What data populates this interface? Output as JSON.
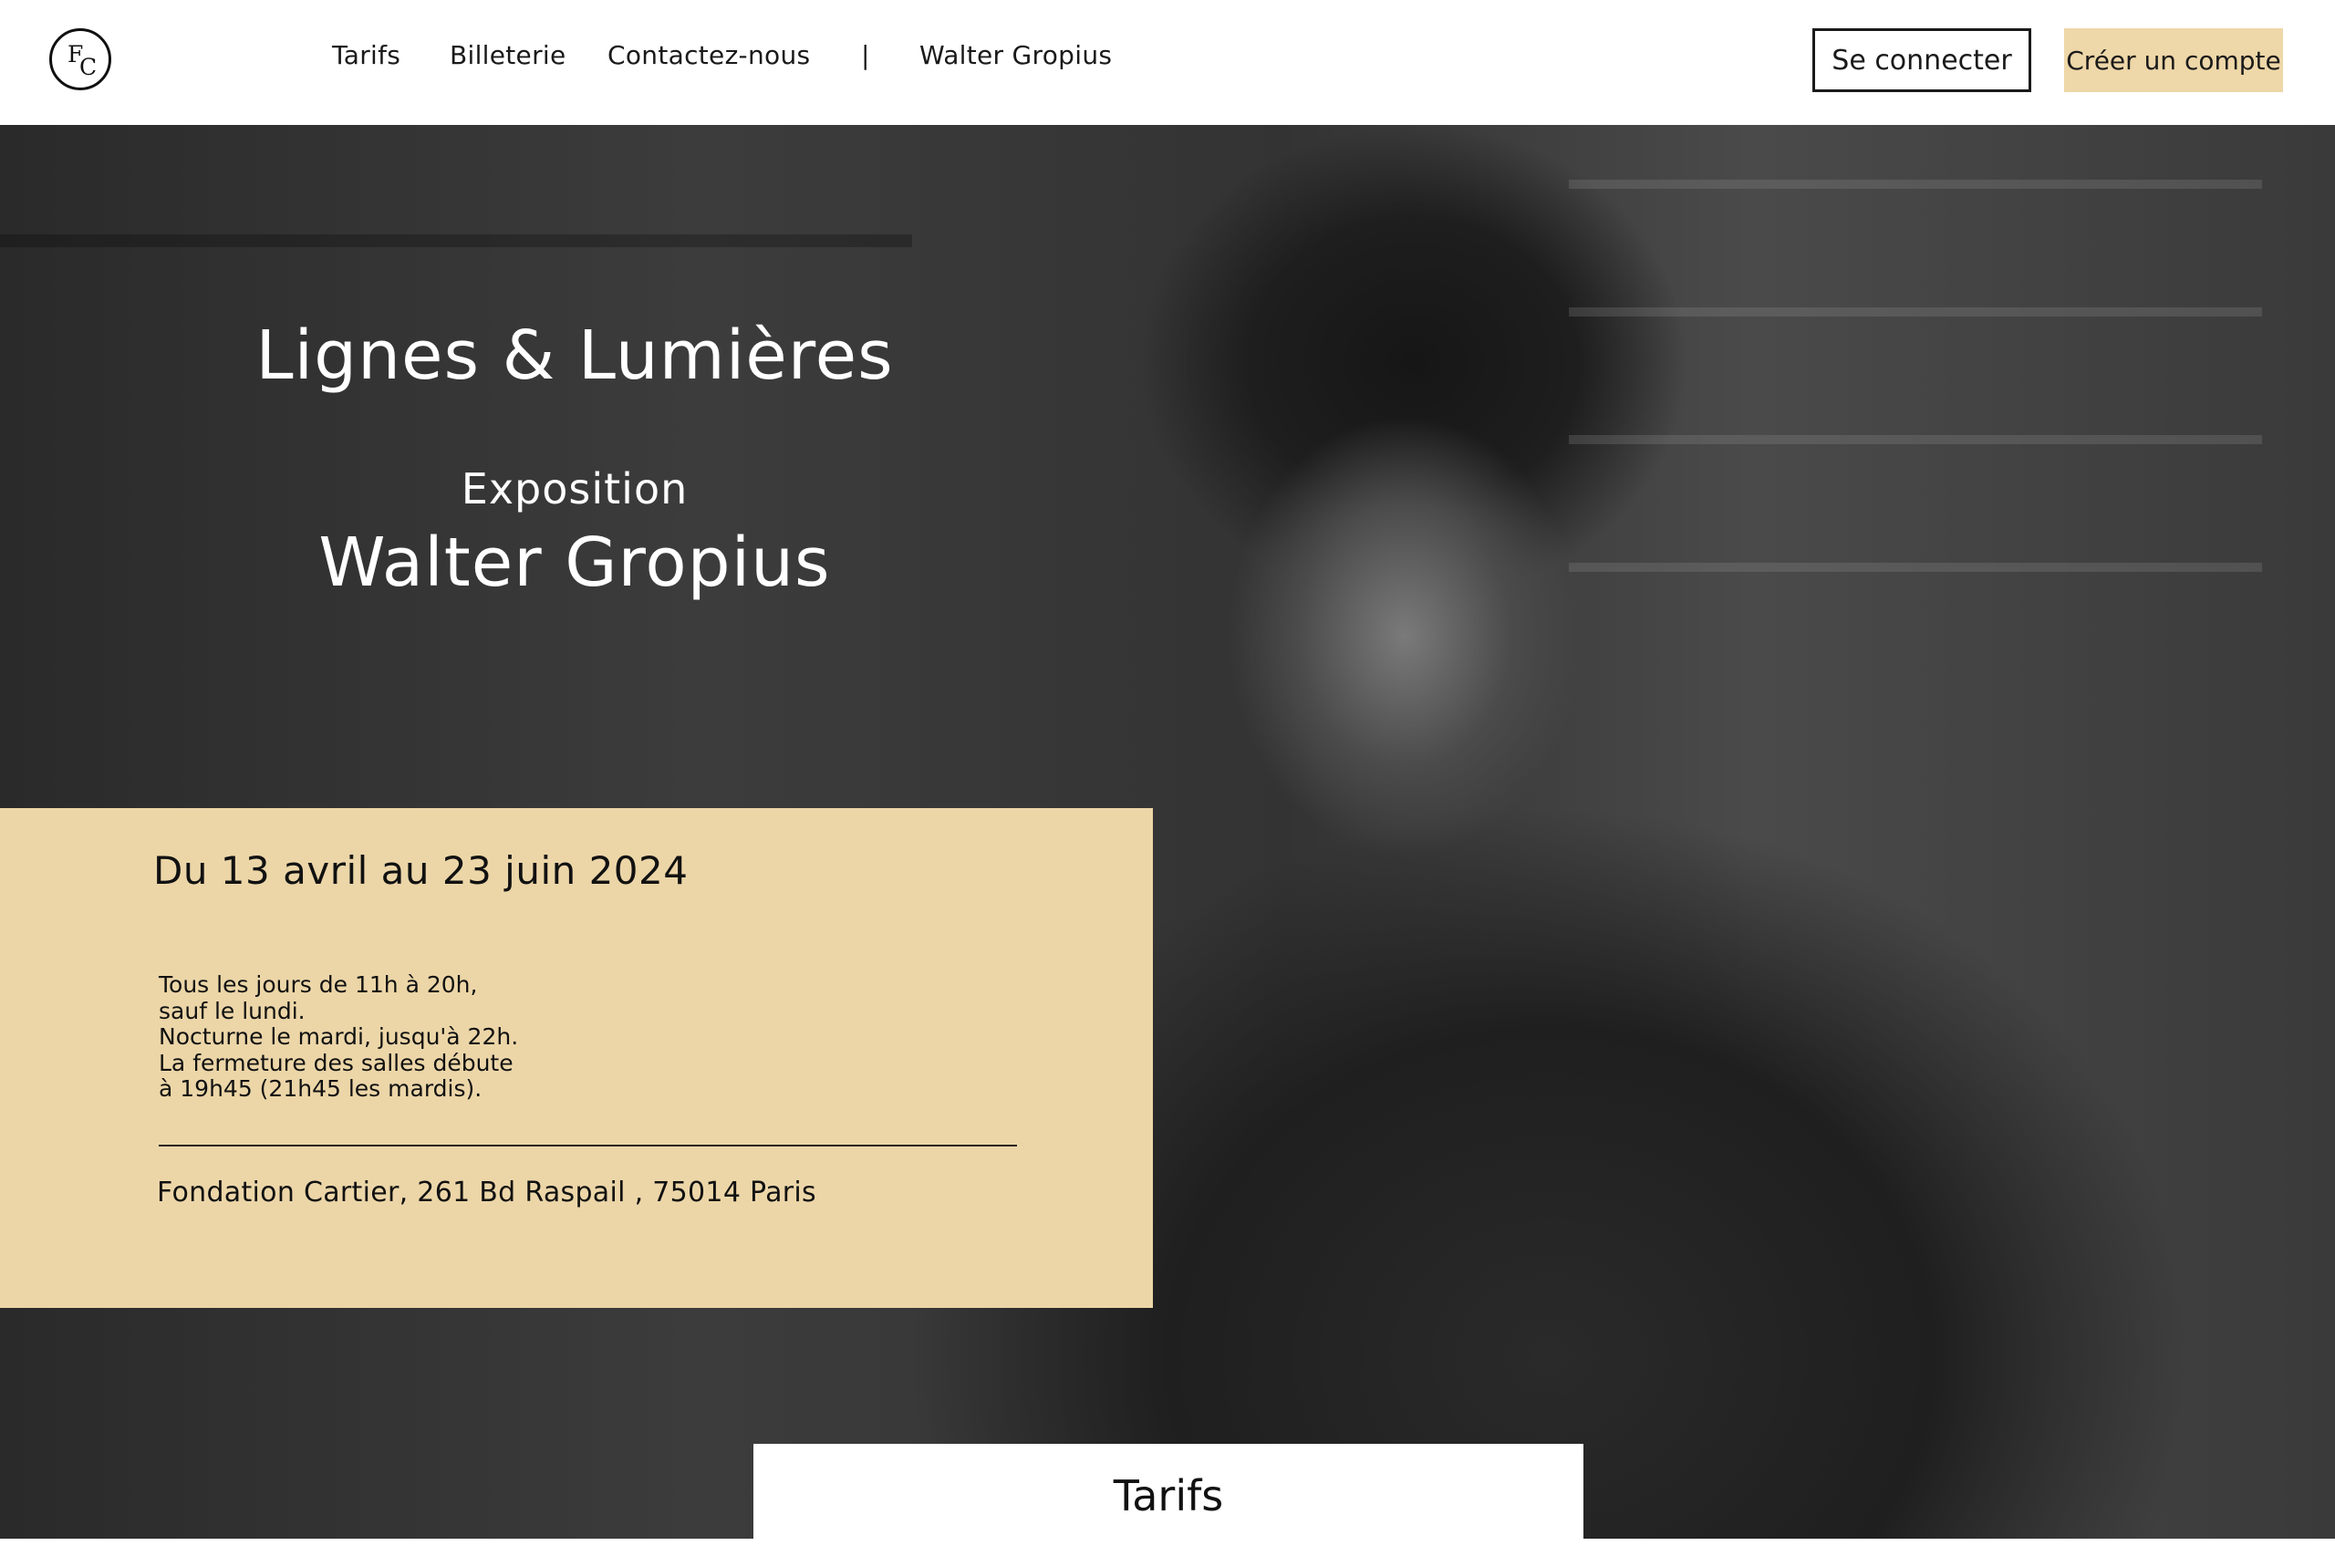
{
  "brand": {
    "logo_f": "F",
    "logo_c": "C"
  },
  "nav": {
    "items": [
      {
        "label": "Tarifs"
      },
      {
        "label": "Billeterie"
      },
      {
        "label": "Contactez-nous"
      },
      {
        "label": "|"
      },
      {
        "label": "Walter Gropius"
      }
    ]
  },
  "auth": {
    "login_label": "Se connecter",
    "signup_label": "Créer un compte"
  },
  "hero": {
    "title": "Lignes & Lumières",
    "kicker": "Exposition",
    "name": "Walter Gropius"
  },
  "info": {
    "dates": "Du 13 avril au 23 juin 2024",
    "hours_lines": [
      "Tous les jours de 11h à 20h,",
      "sauf le lundi.",
      "Nocturne le mardi, jusqu'à 22h.",
      "La fermeture des salles débute",
      "à 19h45 (21h45 les mardis)."
    ],
    "address": "Fondation Cartier, 261 Bd Raspail , 75014 Paris"
  },
  "section": {
    "tab_label": "Tarifs"
  },
  "colors": {
    "accent": "#ECD6A8",
    "text": "#111111",
    "background": "#FFFFFF"
  }
}
